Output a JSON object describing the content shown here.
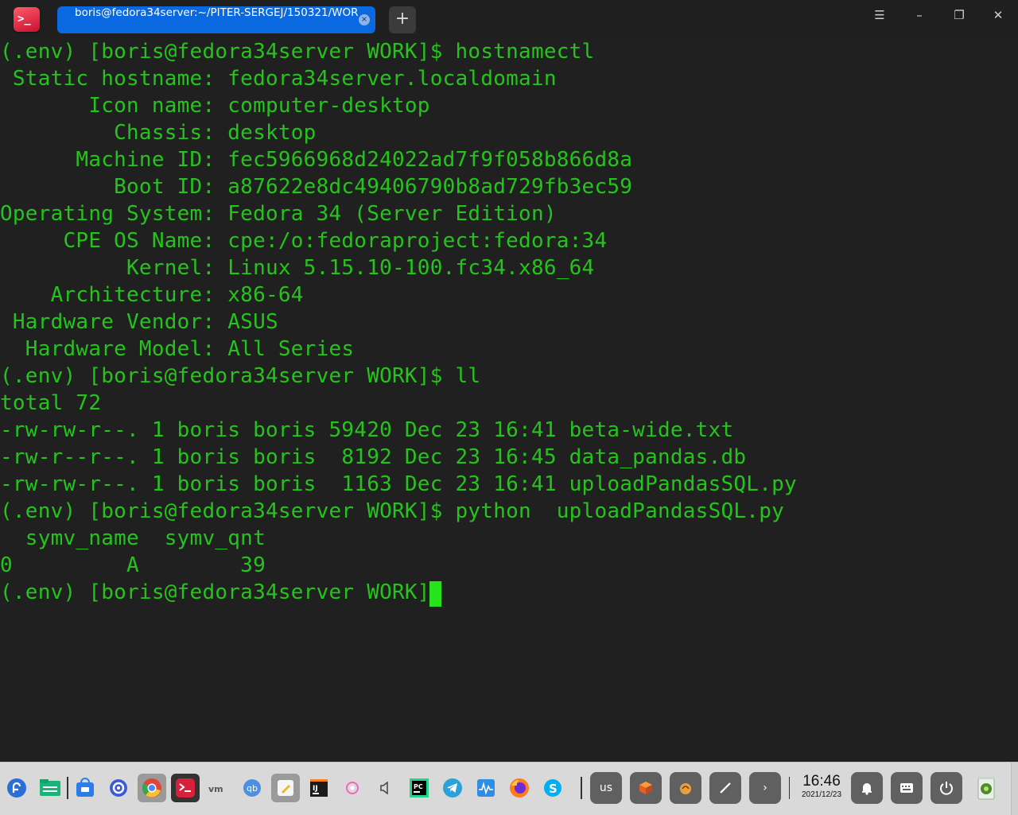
{
  "window": {
    "tab_title": "boris@fedora34server:~/PITER-SERGEJ/150321/WORK",
    "app_icon_glyph": ">_",
    "new_tab_glyph": "+",
    "tab_close_glyph": "×",
    "menu_glyph": "☰",
    "minimize_glyph": "–",
    "maximize_glyph": "❐",
    "close_glyph": "✕"
  },
  "terminal": {
    "colors": {
      "text": "#25c41c",
      "cursor": "#26e31c",
      "background": "#202020"
    },
    "lines": [
      "(.env) [boris@fedora34server WORK]$ hostnamectl",
      " Static hostname: fedora34server.localdomain",
      "       Icon name: computer-desktop",
      "         Chassis: desktop",
      "      Machine ID: fec5966968d24022ad7f9f058b866d8a",
      "         Boot ID: a87622e8dc49406790b8ad729fb3ec59",
      "Operating System: Fedora 34 (Server Edition)",
      "     CPE OS Name: cpe:/o:fedoraproject:fedora:34",
      "          Kernel: Linux 5.15.10-100.fc34.x86_64",
      "    Architecture: x86-64",
      " Hardware Vendor: ASUS",
      "  Hardware Model: All Series",
      "(.env) [boris@fedora34server WORK]$ ll",
      "total 72",
      "-rw-rw-r--. 1 boris boris 59420 Dec 23 16:41 beta-wide.txt",
      "-rw-r--r--. 1 boris boris  8192 Dec 23 16:45 data_pandas.db",
      "-rw-rw-r--. 1 boris boris  1163 Dec 23 16:41 uploadPandasSQL.py",
      "(.env) [boris@fedora34server WORK]$ python  uploadPandasSQL.py",
      "  symv_name  symv_qnt",
      "0         A        39",
      "(.env) [boris@fedora34server WORK]$ "
    ]
  },
  "taskbar": {
    "apps": [
      {
        "name": "launcher-icon",
        "color": "#2a6fd6"
      },
      {
        "name": "file-manager-icon",
        "color": "#1bb37a"
      },
      {
        "name": "app-store-icon",
        "color": "#2b7de9"
      },
      {
        "name": "settings-icon",
        "color": "#3c5bd6"
      },
      {
        "name": "chrome-icon",
        "color": "#e0443a"
      },
      {
        "name": "terminal-icon",
        "color": "#d8203a"
      },
      {
        "name": "vm-icon",
        "color": "#8a8a8a"
      },
      {
        "name": "qbittorrent-icon",
        "color": "#4f8fe0"
      },
      {
        "name": "text-editor-icon",
        "color": "#f0b820"
      },
      {
        "name": "intellij-icon",
        "color": "#1a1a1a"
      },
      {
        "name": "disc-icon",
        "color": "#d07aa8"
      },
      {
        "name": "speaker-icon",
        "color": "#444444"
      },
      {
        "name": "pycharm-icon",
        "color": "#21d789"
      },
      {
        "name": "telegram-icon",
        "color": "#2aa1da"
      },
      {
        "name": "system-monitor-icon",
        "color": "#2f8de4"
      },
      {
        "name": "firefox-icon",
        "color": "#ff7b1c"
      },
      {
        "name": "skype-icon",
        "color": "#00aff0"
      }
    ],
    "tray": {
      "keyboard_layout": "us",
      "arrow_glyph": "›",
      "clock_time": "16:46",
      "clock_date": "2021/12/23"
    }
  }
}
